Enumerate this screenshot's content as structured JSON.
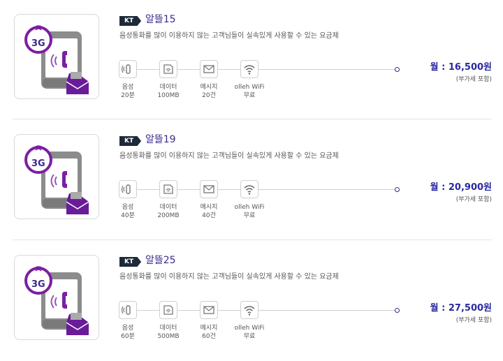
{
  "plans": [
    {
      "badge": "KT",
      "name": "알뜰15",
      "description": "음성통화를 많이 이용하지 않는 고객님들이 실속있게 사용할 수 있는 요금제",
      "thumb_text": "3G",
      "features": [
        {
          "label": "음성",
          "value": "20분",
          "icon": "phone-icon"
        },
        {
          "label": "데이터",
          "value": "100MB",
          "icon": "data-icon"
        },
        {
          "label": "메시지",
          "value": "20건",
          "icon": "message-icon"
        },
        {
          "label": "olleh WiFi",
          "value": "무료",
          "icon": "wifi-icon"
        }
      ],
      "price": "월 : 16,500원",
      "vat_note": "(부가세 포함)"
    },
    {
      "badge": "KT",
      "name": "알뜰19",
      "description": "음성통화를 많이 이용하지 않는 고객님들이 실속있게 사용할 수 있는 요금제",
      "thumb_text": "3G",
      "features": [
        {
          "label": "음성",
          "value": "40분",
          "icon": "phone-icon"
        },
        {
          "label": "데이터",
          "value": "200MB",
          "icon": "data-icon"
        },
        {
          "label": "메시지",
          "value": "40건",
          "icon": "message-icon"
        },
        {
          "label": "olleh WiFi",
          "value": "무료",
          "icon": "wifi-icon"
        }
      ],
      "price": "월 : 20,900원",
      "vat_note": "(부가세 포함)"
    },
    {
      "badge": "KT",
      "name": "알뜰25",
      "description": "음성통화를 많이 이용하지 않는 고객님들이 실속있게 사용할 수 있는 요금제",
      "thumb_text": "3G",
      "features": [
        {
          "label": "음성",
          "value": "60분",
          "icon": "phone-icon"
        },
        {
          "label": "데이터",
          "value": "500MB",
          "icon": "data-icon"
        },
        {
          "label": "메시지",
          "value": "60건",
          "icon": "message-icon"
        },
        {
          "label": "olleh WiFi",
          "value": "무료",
          "icon": "wifi-icon"
        }
      ],
      "price": "월 : 27,500원",
      "vat_note": "(부가세 포함)"
    }
  ],
  "colors": {
    "accent": "#3b2a8c",
    "price": "#2a2aa0",
    "badge_bg": "#1e2a3a",
    "phone_gray": "#888888",
    "purple": "#7b1fa2"
  }
}
